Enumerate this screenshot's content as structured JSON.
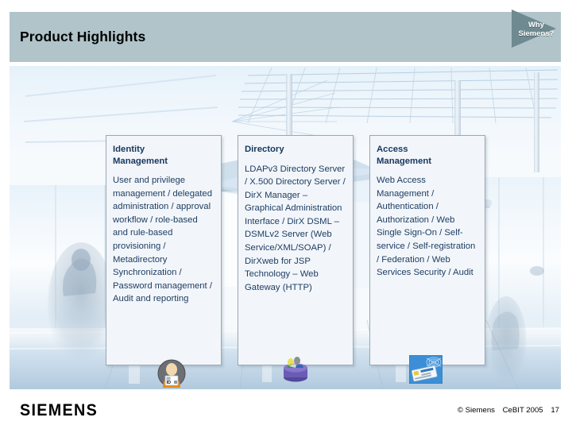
{
  "header": {
    "title": "Product Highlights",
    "band_color": "#b0c4ca",
    "flag": {
      "line1": "Why",
      "line2": "Siemens?",
      "triangle_color": "#6f8a90",
      "text_color": "#ffffff"
    }
  },
  "cards": [
    {
      "title": "Identity\nManagement",
      "body": "User and privilege management / delegated administration / approval workflow / role-based and rule-based provisioning / Metadirectory Synchronization / Password management / Audit and reporting",
      "icon": "id-badge-person-icon"
    },
    {
      "title": "Directory",
      "body": "LDAPv3 Directory Server / X.500 Directory Server / DirX Manager – Graphical Administration Interface / DirX DSML – DSMLv2 Server (Web Service/XML/SOAP) / DirXweb for JSP Technology – Web Gateway (HTTP)",
      "icon": "database-cylinder-icon"
    },
    {
      "title": "Access\nManagement",
      "body": "Web Access Management / Authentication / Authorization / Web Single Sign-On / Self-service / Self-registration / Federation / Web Services Security / Audit",
      "icon": "smart-card-icon"
    }
  ],
  "theme": {
    "card_bg": "#f2f6fa",
    "card_border": "#9aa7b2",
    "heading_color": "#17375e",
    "body_color": "#1f3d63"
  },
  "footer": {
    "wordmark": "SIEMENS",
    "copyright": "© Siemens",
    "event": "CeBIT 2005",
    "page_number": "17"
  }
}
